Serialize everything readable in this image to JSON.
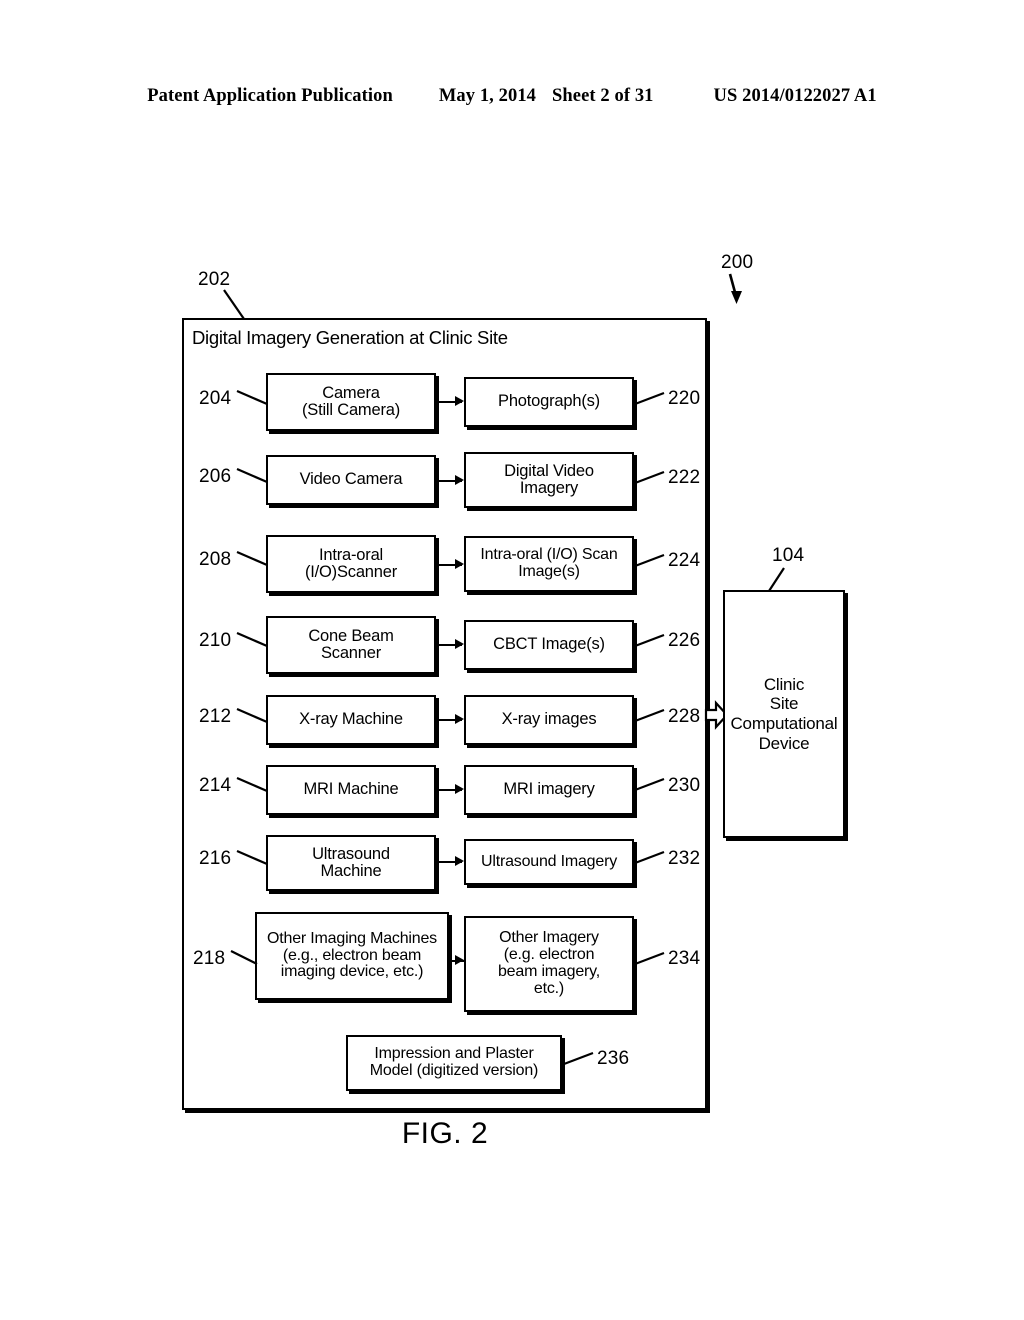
{
  "header": {
    "publication": "Patent Application Publication",
    "date": "May 1, 2014",
    "sheet": "Sheet 2 of 31",
    "patent_number": "US 2014/0122027 A1"
  },
  "figure": {
    "caption": "FIG. 2",
    "system_ref": "200",
    "container": {
      "ref": "202",
      "title": "Digital Imagery Generation at Clinic Site"
    },
    "rows": [
      {
        "source_ref": "204",
        "source_label": [
          "Camera",
          "(Still Camera)"
        ],
        "output_ref": "220",
        "output_label": [
          "Photograph(s)"
        ]
      },
      {
        "source_ref": "206",
        "source_label": [
          "Video Camera"
        ],
        "output_ref": "222",
        "output_label": [
          "Digital Video",
          "Imagery"
        ]
      },
      {
        "source_ref": "208",
        "source_label": [
          "Intra-oral",
          "(I/O)Scanner"
        ],
        "output_ref": "224",
        "output_label": [
          "Intra-oral (I/O) Scan",
          "Image(s)"
        ]
      },
      {
        "source_ref": "210",
        "source_label": [
          "Cone Beam",
          "Scanner"
        ],
        "output_ref": "226",
        "output_label": [
          "CBCT Image(s)"
        ]
      },
      {
        "source_ref": "212",
        "source_label": [
          "X-ray Machine"
        ],
        "output_ref": "228",
        "output_label": [
          "X-ray images"
        ]
      },
      {
        "source_ref": "214",
        "source_label": [
          "MRI Machine"
        ],
        "output_ref": "230",
        "output_label": [
          "MRI imagery"
        ]
      },
      {
        "source_ref": "216",
        "source_label": [
          "Ultrasound",
          "Machine"
        ],
        "output_ref": "232",
        "output_label": [
          "Ultrasound Imagery"
        ]
      },
      {
        "source_ref": "218",
        "source_label": [
          "Other Imaging Machines",
          "(e.g., electron beam",
          "imaging device, etc.)"
        ],
        "output_ref": "234",
        "output_label": [
          "Other Imagery",
          "(e.g. electron",
          "beam imagery,",
          "etc.)"
        ]
      }
    ],
    "standalone_box": {
      "ref": "236",
      "label": [
        "Impression and Plaster",
        "Model (digitized version)"
      ]
    },
    "destination": {
      "ref": "104",
      "label": [
        "Clinic",
        "Site",
        "Computational",
        "Device"
      ]
    }
  }
}
